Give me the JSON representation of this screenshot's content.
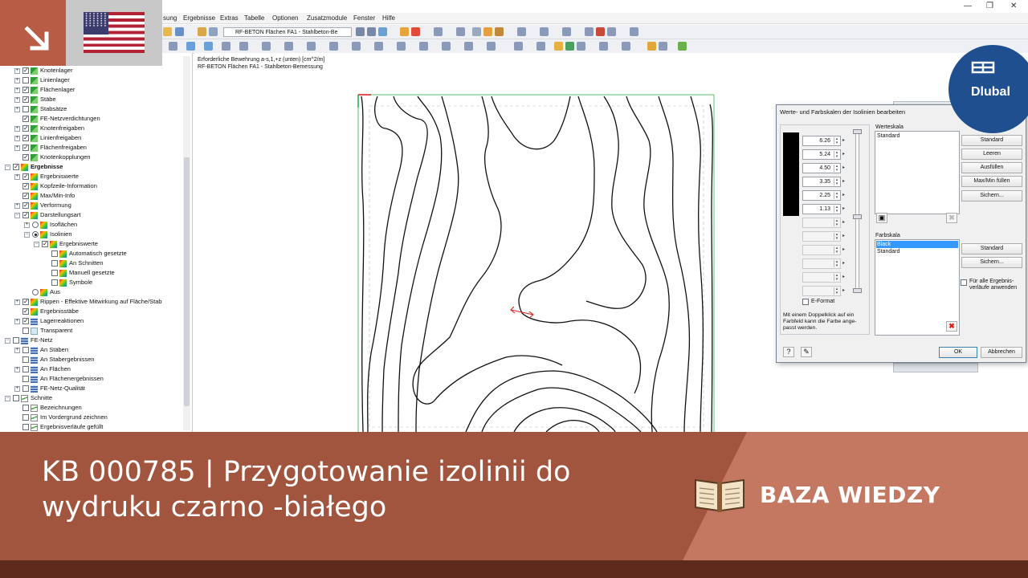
{
  "menubar": {
    "items": [
      "sung",
      "Ergebnisse",
      "Extras",
      "Tabelle",
      "Optionen",
      "Zusatzmodule",
      "Fenster",
      "Hilfe"
    ]
  },
  "toolbar": {
    "module_combo": "RF-BETON Flächen FA1 - Stahlbeton-Be"
  },
  "navigator": {
    "items": [
      {
        "label": "Knotenlager",
        "indent": 2,
        "expand": "+",
        "check": "on",
        "icon": "green"
      },
      {
        "label": "Linienlager",
        "indent": 2,
        "expand": "+",
        "check": "off",
        "icon": "green"
      },
      {
        "label": "Flächenlager",
        "indent": 2,
        "expand": "+",
        "check": "on",
        "icon": "green"
      },
      {
        "label": "Stäbe",
        "indent": 2,
        "expand": "+",
        "check": "on",
        "icon": "green"
      },
      {
        "label": "Stabsätze",
        "indent": 2,
        "expand": "+",
        "check": "off",
        "icon": "green"
      },
      {
        "label": "FE-Netzverdichtungen",
        "indent": 2,
        "expand": "",
        "check": "on",
        "icon": "green"
      },
      {
        "label": "Knotenfreigaben",
        "indent": 2,
        "expand": "+",
        "check": "on",
        "icon": "green"
      },
      {
        "label": "Linienfreigaben",
        "indent": 2,
        "expand": "+",
        "check": "on",
        "icon": "green"
      },
      {
        "label": "Flächenfreigaben",
        "indent": 2,
        "expand": "+",
        "check": "on",
        "icon": "green"
      },
      {
        "label": "Knotenkopplungen",
        "indent": 2,
        "expand": "",
        "check": "on",
        "icon": "green"
      },
      {
        "label": "Ergebnisse",
        "indent": 1,
        "expand": "−",
        "check": "on",
        "icon": "grad",
        "bold": true
      },
      {
        "label": "Ergebniswerte",
        "indent": 2,
        "expand": "+",
        "check": "on",
        "icon": "grad"
      },
      {
        "label": "Kopfzeile-Information",
        "indent": 2,
        "expand": "",
        "check": "on",
        "icon": "grad"
      },
      {
        "label": "Max/Min-Info",
        "indent": 2,
        "expand": "",
        "check": "on",
        "icon": "grad"
      },
      {
        "label": "Verformung",
        "indent": 2,
        "expand": "+",
        "check": "on",
        "icon": "grad"
      },
      {
        "label": "Darstellungsart",
        "indent": 2,
        "expand": "−",
        "check": "on",
        "icon": "grad"
      },
      {
        "label": "Isoflächen",
        "indent": 3,
        "expand": "+",
        "radio": "off",
        "icon": "grad"
      },
      {
        "label": "Isolinien",
        "indent": 3,
        "expand": "−",
        "radio": "on",
        "icon": "grad"
      },
      {
        "label": "Ergebniswerte",
        "indent": 4,
        "expand": "−",
        "check": "on",
        "icon": "grad"
      },
      {
        "label": "Automatisch gesetzte",
        "indent": 5,
        "expand": "",
        "check": "off",
        "icon": "grad"
      },
      {
        "label": "An Schnitten",
        "indent": 5,
        "expand": "",
        "check": "off",
        "icon": "grad"
      },
      {
        "label": "Manuell gesetzte",
        "indent": 5,
        "expand": "",
        "check": "off",
        "icon": "grad"
      },
      {
        "label": "Symbole",
        "indent": 5,
        "expand": "",
        "check": "off",
        "icon": "grad"
      },
      {
        "label": "Aus",
        "indent": 3,
        "expand": "",
        "radio": "off",
        "icon": "grad"
      },
      {
        "label": "Rippen - Effektive Mitwirkung auf Fläche/Stab",
        "indent": 2,
        "expand": "+",
        "check": "on",
        "icon": "grad"
      },
      {
        "label": "Ergebnisstäbe",
        "indent": 2,
        "expand": "",
        "check": "on",
        "icon": "grad"
      },
      {
        "label": "Lagerreaktionen",
        "indent": 2,
        "expand": "+",
        "check": "on",
        "icon": "grid"
      },
      {
        "label": "Transparent",
        "indent": 2,
        "expand": "",
        "check": "off",
        "icon": "plain"
      },
      {
        "label": "FE-Netz",
        "indent": 1,
        "expand": "−",
        "check": "off",
        "icon": "grid"
      },
      {
        "label": "An Stäben",
        "indent": 2,
        "expand": "+",
        "check": "off",
        "icon": "grid"
      },
      {
        "label": "An Stabergebnissen",
        "indent": 2,
        "expand": "",
        "check": "off",
        "icon": "grid"
      },
      {
        "label": "An Flächen",
        "indent": 2,
        "expand": "+",
        "check": "off",
        "icon": "grid"
      },
      {
        "label": "An Flächenergebnissen",
        "indent": 2,
        "expand": "",
        "check": "off",
        "icon": "grid"
      },
      {
        "label": "FE-Netz-Qualität",
        "indent": 2,
        "expand": "+",
        "check": "off",
        "icon": "grid"
      },
      {
        "label": "Schnitte",
        "indent": 1,
        "expand": "−",
        "check": "off",
        "icon": "cut"
      },
      {
        "label": "Bezeichnungen",
        "indent": 2,
        "expand": "",
        "check": "off",
        "icon": "cut"
      },
      {
        "label": "Im Vordergrund zeichnen",
        "indent": 2,
        "expand": "",
        "check": "off",
        "icon": "cut"
      },
      {
        "label": "Ergebnisverläufe gefüllt",
        "indent": 2,
        "expand": "",
        "check": "off",
        "icon": "cut"
      }
    ]
  },
  "canvas": {
    "info_line1": "Erforderliche Bewehrung a-s,1,+z (unten) [cm^2/m]",
    "info_line2": "RF-BETON Flächen FA1 - Stahlbeton-Bemessung"
  },
  "dialog": {
    "title": "Werte- und Farbskalen der Isolinien bearbeiten",
    "values": [
      "6.26",
      "5.24",
      "4.50",
      "3.35",
      "2.25",
      "1.13",
      "",
      "",
      "",
      "",
      "",
      ""
    ],
    "color_fill": "#000000",
    "e_format_label": "E-Format",
    "note": "Mit einem Doppelklick auf ein Farbfeld kann die Farbe ange-passt werden.",
    "werteskala": {
      "label": "Werteskala",
      "items": [
        "Standard"
      ],
      "buttons": [
        "Standard",
        "Leeren",
        "Ausfüllen",
        "Max/Min füllen",
        "Sichern..."
      ]
    },
    "farbskala": {
      "label": "Farbskala",
      "items": [
        "Black",
        "Standard"
      ],
      "selected": "Black",
      "buttons": [
        "Standard",
        "Sichern..."
      ]
    },
    "apply_all_label": "Für alle Ergebnis-verläufe anwenden",
    "ok_label": "OK",
    "cancel_label": "Abbrechen"
  },
  "banner": {
    "title": "KB 000785 | Przygotowanie izolinii do wydruku czarno -białego",
    "section_label": "BAZA WIEDZY",
    "brand": "Dlubal",
    "colors": {
      "main": "#a1553f",
      "light": "#c47862",
      "footer": "#5e2a1c",
      "arrow_tile": "#b85c46",
      "logo": "#1f4f8e"
    }
  }
}
